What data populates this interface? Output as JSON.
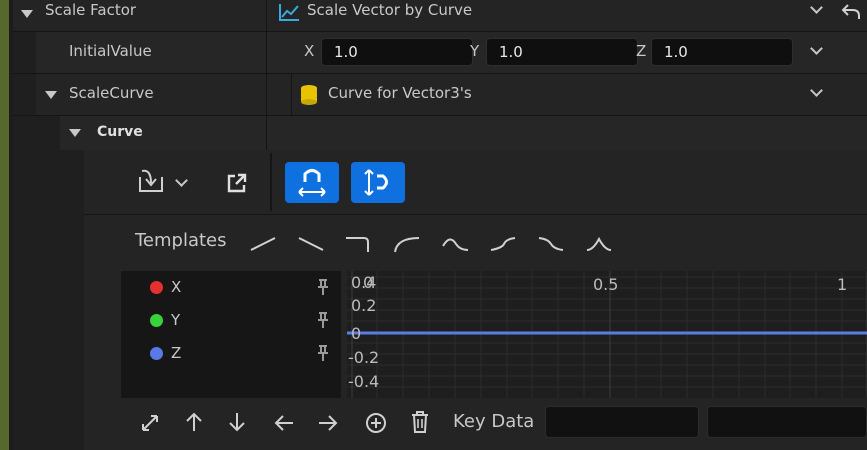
{
  "colors": {
    "accent_strip": "#56682e",
    "blue_button": "#0f70e0",
    "curve_line": "#5a7ee0",
    "x_channel": "#e53030",
    "y_channel": "#37d23c",
    "z_channel": "#5a78e6",
    "curve_icon": "#e8c400"
  },
  "scale_factor": {
    "label": "Scale Factor",
    "value": "Scale Vector by Curve",
    "value_icon": "graph-icon",
    "reset_icon": "reset-arrow-icon"
  },
  "initial_value": {
    "label": "InitialValue",
    "x_label": "X",
    "x_value": "1.0",
    "y_label": "Y",
    "y_value": "1.0",
    "z_label": "Z",
    "z_value": "1.0"
  },
  "scale_curve": {
    "label": "ScaleCurve",
    "value": "Curve for Vector3's",
    "value_icon": "curve-asset-icon"
  },
  "curve": {
    "label": "Curve"
  },
  "toolbar": {
    "icons": [
      "import-curve-icon",
      "dropdown-chevron-icon",
      "open-external-icon",
      "snap-magnet-horizontal-icon",
      "snap-magnet-vertical-icon"
    ]
  },
  "templates": {
    "label": "Templates",
    "icons": [
      "linear-up-icon",
      "linear-down-icon",
      "ease-out-step-icon",
      "ease-in-icon",
      "ease-out-icon",
      "s-curve-up-icon",
      "s-curve-down-icon",
      "bell-icon"
    ]
  },
  "channels": [
    {
      "name": "X",
      "pin_icon": "pin-icon"
    },
    {
      "name": "Y",
      "pin_icon": "pin-icon"
    },
    {
      "name": "Z",
      "pin_icon": "pin-icon"
    }
  ],
  "graph": {
    "x_ticks": [
      "0",
      "0.5",
      "1"
    ],
    "y_ticks": [
      "0.4",
      "0.2",
      "0",
      "-0.2",
      "-0.4"
    ]
  },
  "bottom_toolbar": {
    "icons": [
      "fit-view-icon",
      "arrow-up-icon",
      "arrow-down-icon",
      "arrow-left-icon",
      "arrow-right-icon",
      "add-key-icon",
      "delete-icon"
    ],
    "key_data_label": "Key Data"
  }
}
